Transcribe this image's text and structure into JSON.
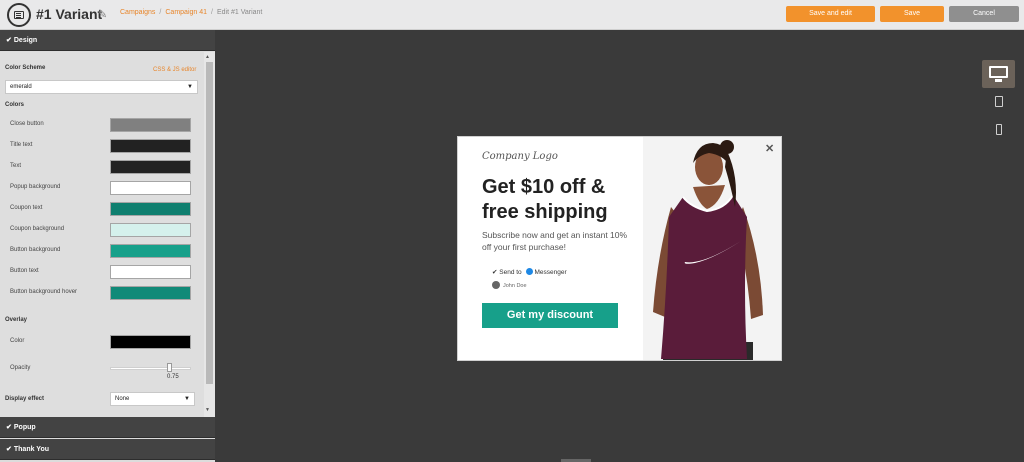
{
  "header": {
    "title": "#1 Variant",
    "breadcrumbs": [
      "Campaigns",
      "Campaign 41",
      "Edit #1 Variant"
    ],
    "buttons": {
      "save_and_edit": "Save and edit",
      "save": "Save",
      "cancel": "Cancel"
    }
  },
  "sidebar": {
    "sections": {
      "design": "Design",
      "popup": "Popup",
      "thank_you": "Thank You"
    },
    "color_scheme": {
      "label": "Color Scheme",
      "css_link": "CSS & JS editor",
      "value": "emerald"
    },
    "colors": {
      "label": "Colors",
      "items": [
        {
          "label": "Close button",
          "color": "#808080"
        },
        {
          "label": "Title text",
          "color": "#222222"
        },
        {
          "label": "Text",
          "color": "#222222"
        },
        {
          "label": "Popup background",
          "color": "#ffffff"
        },
        {
          "label": "Coupon text",
          "color": "#0f7f6f"
        },
        {
          "label": "Coupon background",
          "color": "#d5f1ec"
        },
        {
          "label": "Button background",
          "color": "#17a08a"
        },
        {
          "label": "Button text",
          "color": "#ffffff"
        },
        {
          "label": "Button background hover",
          "color": "#118a78"
        }
      ]
    },
    "overlay": {
      "label": "Overlay",
      "color_label": "Color",
      "color": "#000000",
      "opacity_label": "Opacity",
      "opacity": "0.75"
    },
    "display_effect": {
      "label": "Display effect",
      "value": "None"
    }
  },
  "popup": {
    "logo": "Company Logo",
    "headline": "Get $10 off & free shipping",
    "subtext": "Subscribe now and get an instant 10% off your first purchase!",
    "send_to": "Send to",
    "messenger": "Messenger",
    "user": "John Doe",
    "cta": "Get my discount"
  },
  "colors": {
    "accent": "#f2922c",
    "link": "#e8852a",
    "emerald": "#17a08a",
    "cancel": "#8f8f8f"
  }
}
